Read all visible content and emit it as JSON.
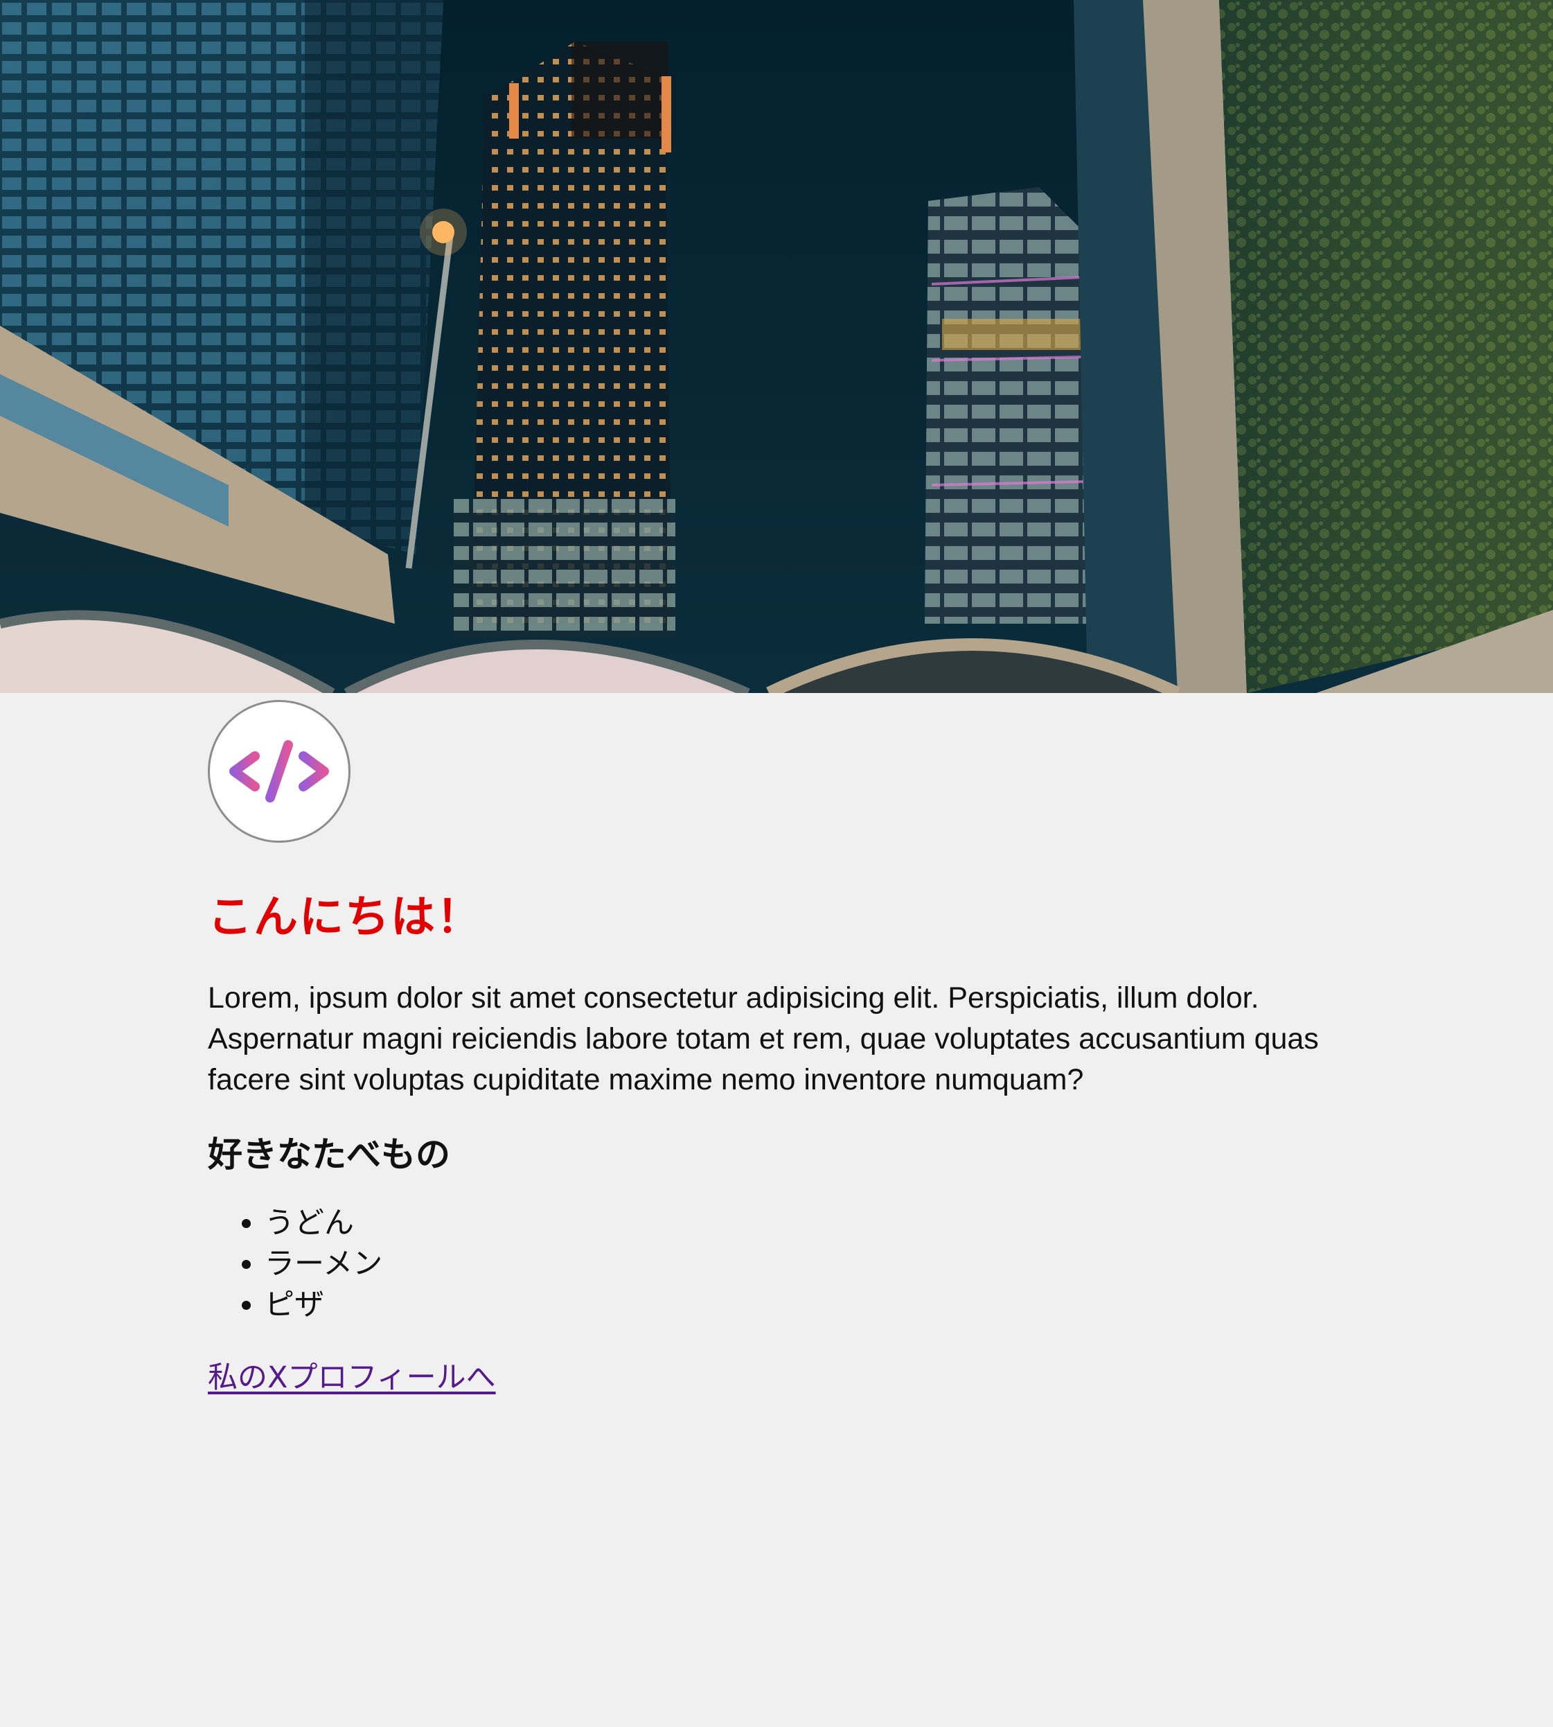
{
  "hero": {
    "image_alt": "night city skyline"
  },
  "avatar": {
    "icon": "code-brackets-icon",
    "glyph": "</>",
    "color_start": "#9a5cd6",
    "color_end": "#e0569a"
  },
  "greeting": {
    "text": "こんにちは！",
    "color": "#e10000"
  },
  "intro": {
    "text": "Lorem, ipsum dolor sit amet consectetur adipisicing elit. Perspiciatis, illum dolor. Aspernatur magni reiciendis labore totam et rem, quae voluptates accusantium quas facere sint voluptas cupiditate maxime nemo inventore numquam?"
  },
  "foods": {
    "heading": "好きなたべもの",
    "items": [
      {
        "label": "うどん"
      },
      {
        "label": "ラーメン"
      },
      {
        "label": "ピザ"
      }
    ]
  },
  "link": {
    "label": "私のXプロフィールへ",
    "color": "#551a8b"
  }
}
